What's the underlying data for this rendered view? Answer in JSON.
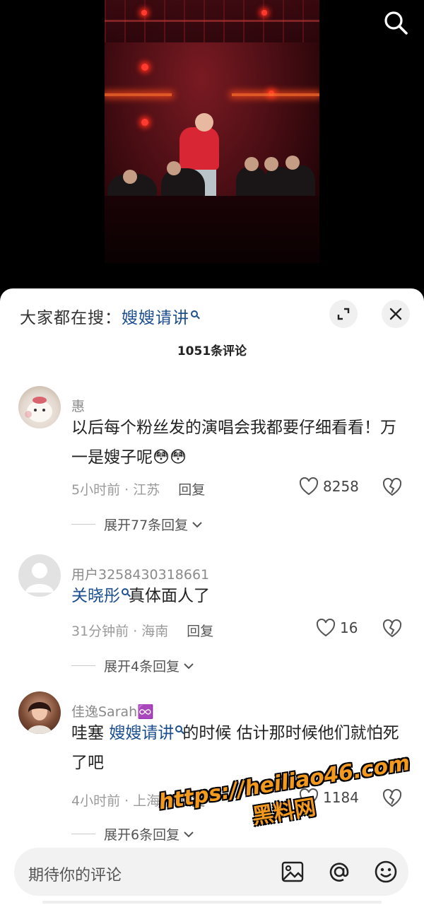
{
  "video": {
    "search_icon": "search-icon"
  },
  "sheet": {
    "search_prompt_prefix": "大家都在搜：",
    "search_keyword": "嫂嫂请讲",
    "comment_count": "1051条评论",
    "expand_icon": "expand-icon",
    "close_icon": "close-icon"
  },
  "comments": [
    {
      "username": "惠",
      "text": "以后每个粉丝发的演唱会我都要仔细看看！万一是嫂子呢😳😳",
      "time_location": "5小时前 · 江苏",
      "reply_label": "回复",
      "likes": "8258",
      "expand_label": "展开77条回复"
    },
    {
      "username": "用户3258430318661",
      "text_keyword": "关晓彤",
      "text": "真体面人了",
      "time_location": "31分钟前 · 海南",
      "reply_label": "回复",
      "likes": "16",
      "expand_label": "展开4条回复"
    },
    {
      "username": "佳逸Sarah♾️",
      "text_prefix": "哇塞 ",
      "text_keyword": "嫂嫂请讲",
      "text": "的时候 估计那时候他们就怕死了吧",
      "time_location": "4小时前 · 上海",
      "reply_label": "回复",
      "likes": "1184",
      "expand_label": "展开6条回复"
    }
  ],
  "input": {
    "placeholder": "期待你的评论"
  },
  "watermark": {
    "url": "https://heiliao46.com",
    "name": "黑料网"
  },
  "colors": {
    "keyword": "#1d4f8f",
    "watermark": "#f39a1e"
  }
}
